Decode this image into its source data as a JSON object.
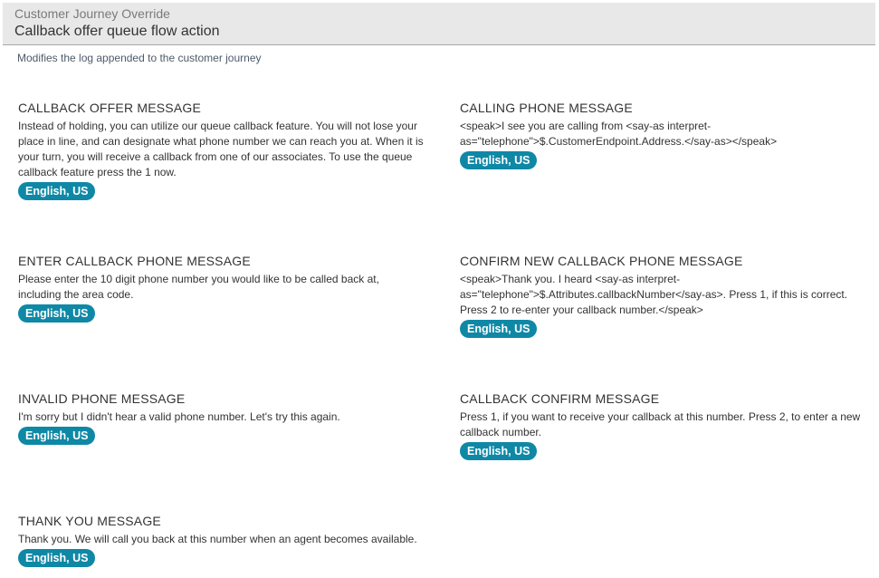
{
  "header": {
    "super_title": "Customer Journey Override",
    "title": "Callback offer queue flow action"
  },
  "subtitle": "Modifies the log appended to the customer journey",
  "sections": [
    {
      "title": "CALLBACK OFFER MESSAGE",
      "text": "Instead of holding, you can utilize our queue callback feature. You will not lose your place in line, and can designate what phone number we can reach you at. When it is your turn, you will receive a callback from one of our associates. To use the queue callback feature press the 1 now.",
      "language": "English, US"
    },
    {
      "title": "CALLING PHONE MESSAGE",
      "text": "<speak>I see you are calling from <say-as interpret-as=\"telephone\">$.CustomerEndpoint.Address.</say-as></speak>",
      "language": "English, US"
    },
    {
      "title": "ENTER CALLBACK PHONE MESSAGE",
      "text": "Please enter the 10 digit phone number you would like to be called back at, including the area code.",
      "language": "English, US"
    },
    {
      "title": "CONFIRM NEW CALLBACK PHONE MESSAGE",
      "text": "<speak>Thank you. I heard <say-as interpret-as=\"telephone\">$.Attributes.callbackNumber</say-as>. Press 1, if this is correct. Press 2 to re-enter your callback number.</speak>",
      "language": "English, US"
    },
    {
      "title": "INVALID PHONE MESSAGE",
      "text": "I'm sorry but I didn't hear a valid phone number. Let's try this again.",
      "language": "English, US"
    },
    {
      "title": "CALLBACK CONFIRM MESSAGE",
      "text": "Press 1, if you want to receive your callback at this number. Press 2, to enter a new callback number.",
      "language": "English, US"
    },
    {
      "title": "THANK YOU MESSAGE",
      "text": "Thank you. We will call you back at this number when an agent becomes available.",
      "language": "English, US"
    }
  ],
  "colors": {
    "badge": "#0f88a6",
    "header_bg": "#e8e8e8"
  }
}
